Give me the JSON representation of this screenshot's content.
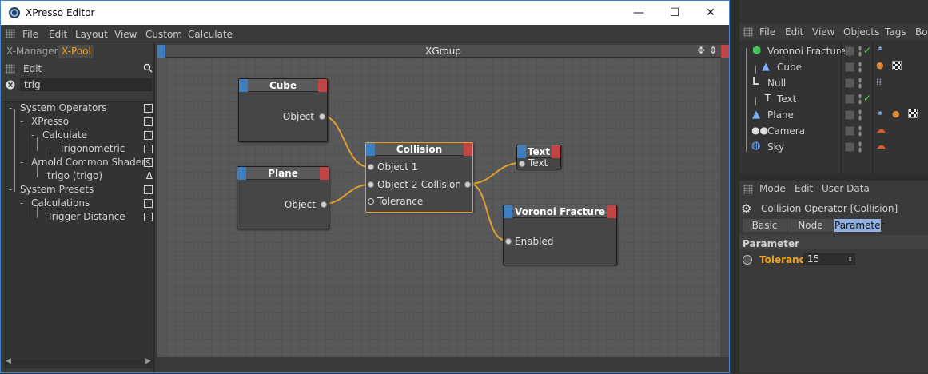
{
  "xpresso": {
    "title": "XPresso Editor",
    "window_controls": {
      "minimize": "—",
      "maximize": "☐",
      "close": "✕"
    },
    "menu": [
      "File",
      "Edit",
      "Layout",
      "View",
      "Custom",
      "Calculate"
    ],
    "tabs": [
      "X-Manager",
      "X-Pool"
    ],
    "active_tab": "X-Pool",
    "pool_menu": "Edit",
    "search_value": "trig",
    "tree": [
      "System Operators",
      "XPresso",
      "Calculate",
      "Trigonometric",
      "Arnold Common Shaders",
      "trigo (trigo)",
      "System Presets",
      "Calculations",
      "Trigger Distance"
    ],
    "canvas_title": "XGroup",
    "nodes": {
      "cube": {
        "title": "Cube",
        "port": "Object"
      },
      "plane": {
        "title": "Plane",
        "port": "Object"
      },
      "collision": {
        "title": "Collision",
        "in1": "Object 1",
        "in2": "Object 2",
        "in3": "Tolerance",
        "out": "Collision"
      },
      "text": {
        "title": "Text",
        "port": "Text"
      },
      "voronoi": {
        "title": "Voronoi Fracture",
        "port": "Enabled"
      }
    },
    "wire_color": "#e0a030",
    "accent": "#f0a020"
  },
  "object_manager": {
    "menu": [
      "File",
      "Edit",
      "View",
      "Objects",
      "Tags",
      "Boo"
    ],
    "objects": [
      "Voronoi Fracture",
      "Cube",
      "Null",
      "Text",
      "Plane",
      "Camera",
      "Sky"
    ]
  },
  "attribute_manager": {
    "menu": [
      "Mode",
      "Edit",
      "User Data"
    ],
    "title": "Collision Operator [Collision]",
    "tabs": [
      "Basic",
      "Node",
      "Parameter"
    ],
    "active_tab": "Parameter",
    "section": "Parameter",
    "param_label": "Tolerance",
    "param_value": "15"
  }
}
